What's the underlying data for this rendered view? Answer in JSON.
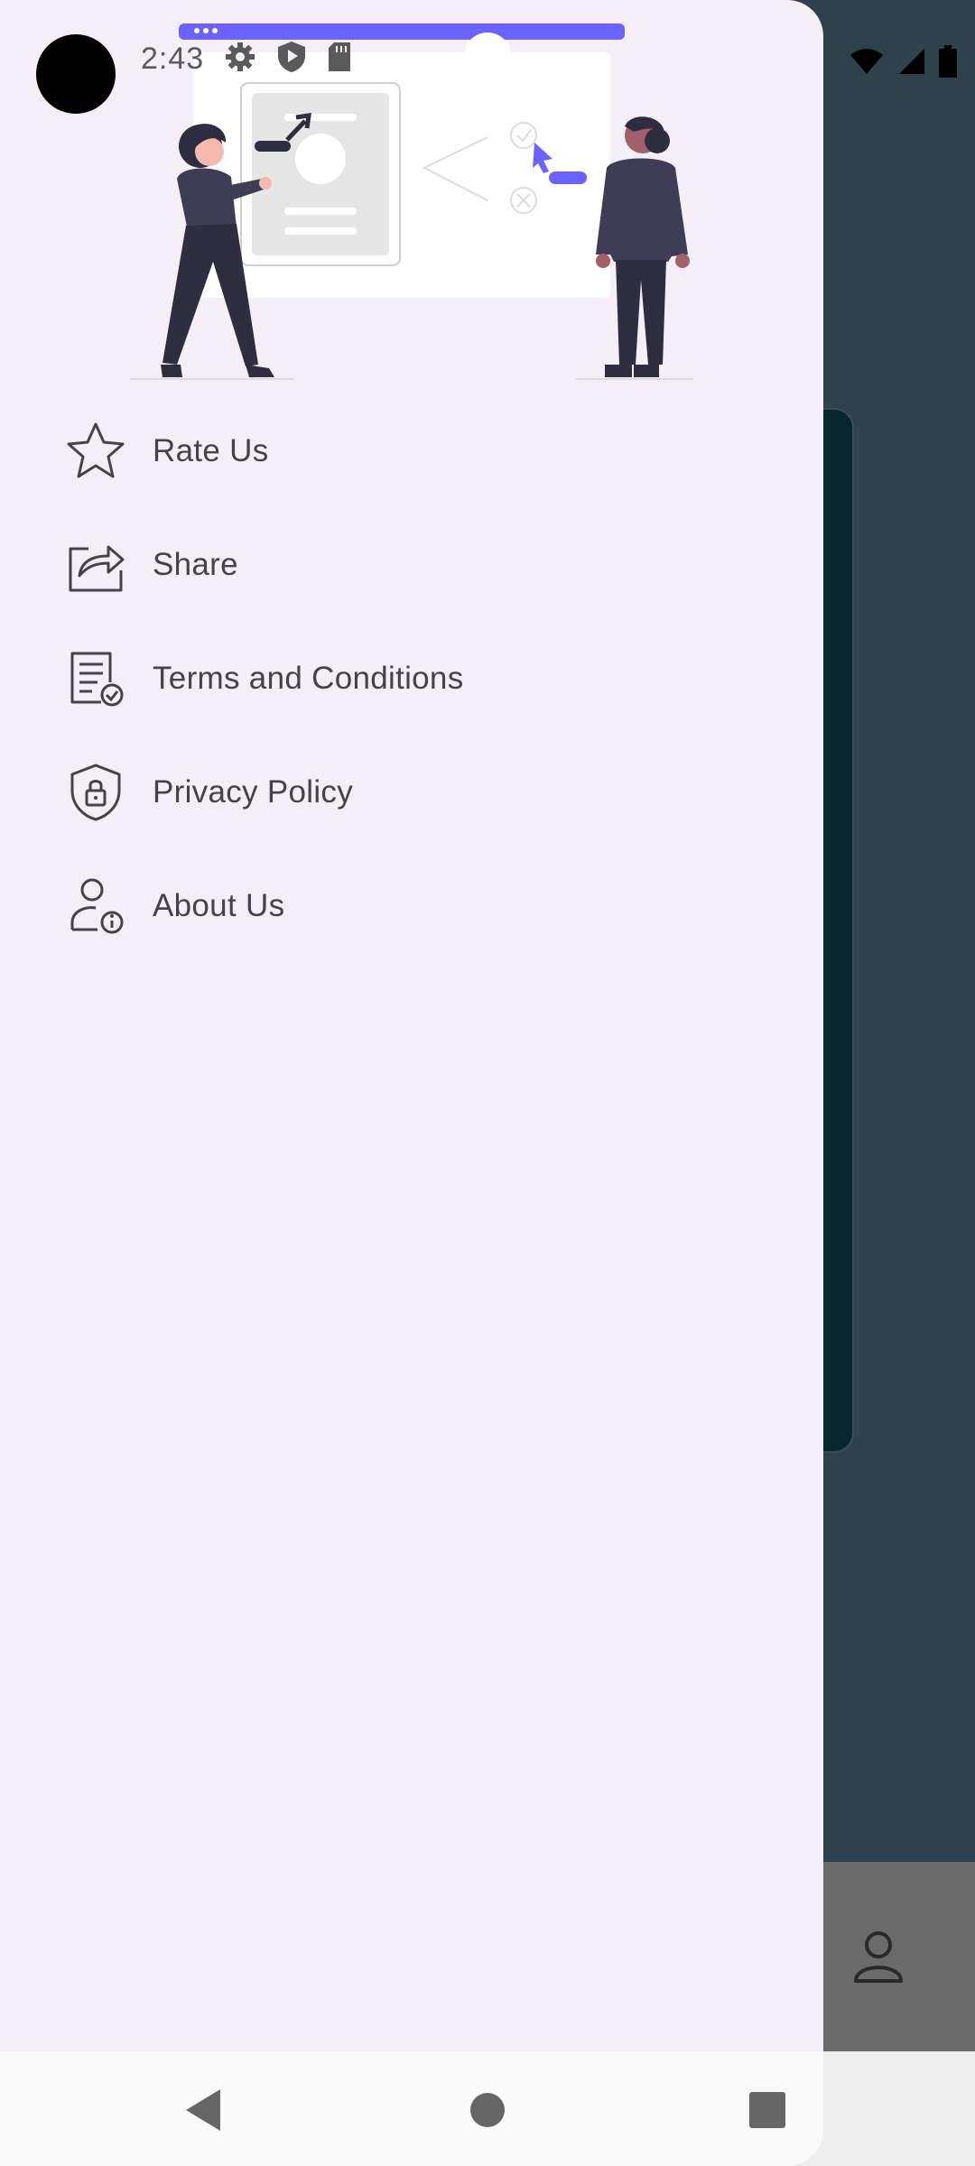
{
  "status_bar": {
    "time": "2:43",
    "left_icons": [
      "settings-icon",
      "shield-play-icon",
      "sd-card-icon"
    ],
    "right_icons": [
      "wifi-icon",
      "cell-signal-icon",
      "battery-icon"
    ]
  },
  "drawer": {
    "header_illustration": "people-presenting-illustration",
    "menu_items": [
      {
        "label": "Rate Us",
        "icon": "star-icon"
      },
      {
        "label": "Share",
        "icon": "share-icon"
      },
      {
        "label": "Terms and Conditions",
        "icon": "document-check-icon"
      },
      {
        "label": "Privacy Policy",
        "icon": "shield-lock-icon"
      },
      {
        "label": "About Us",
        "icon": "user-info-icon"
      }
    ]
  },
  "background_app": {
    "bottom_bar_icon": "profile-icon"
  },
  "system_nav": {
    "buttons": [
      "back-button",
      "home-button",
      "recents-button"
    ]
  },
  "colors": {
    "drawer_bg": "#f4eff7",
    "app_bg": "#2d424c",
    "accent": "#6c63ff",
    "text": "#45434a"
  }
}
